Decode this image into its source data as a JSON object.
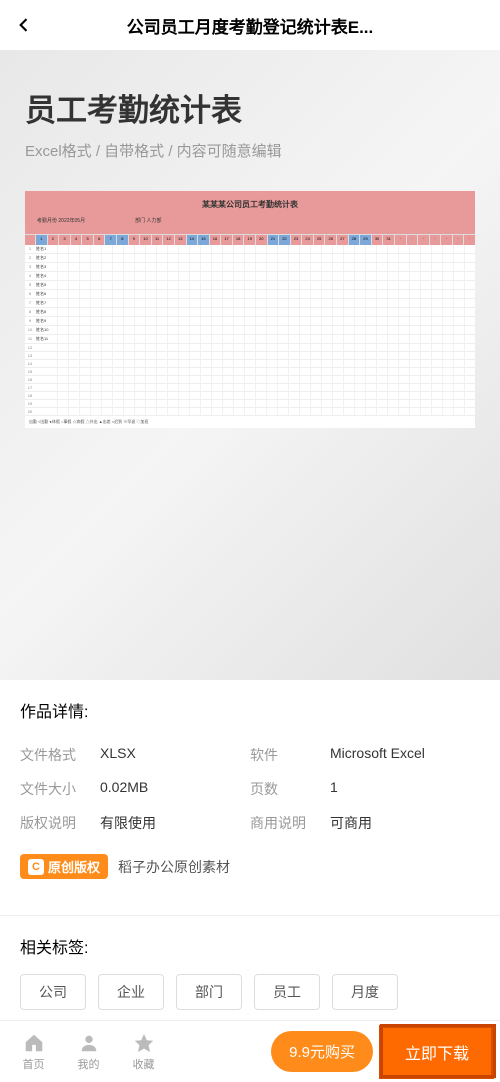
{
  "header": {
    "title": "公司员工月度考勤登记统计表E..."
  },
  "preview": {
    "title": "员工考勤统计表",
    "subtitle": "Excel格式 / 自带格式 / 内容可随意编辑",
    "excel": {
      "title": "某某某公司员工考勤统计表",
      "meta_left": "考勤月份  2022年05月",
      "meta_mid": "部门  人力部",
      "rows": [
        "姓名1",
        "姓名2",
        "姓名3",
        "姓名4",
        "姓名5",
        "姓名6",
        "姓名7",
        "姓名8",
        "姓名9",
        "姓名10",
        "姓名11"
      ],
      "legend": "出勤 √出勤  ●休假  ○事假  ☆病假  △外出  ▲出差  ×迟到  ※早退  ◇加班"
    }
  },
  "details": {
    "section_title": "作品详情:",
    "items": [
      {
        "label": "文件格式",
        "value": "XLSX"
      },
      {
        "label": "软件",
        "value": "Microsoft Excel"
      },
      {
        "label": "文件大小",
        "value": "0.02MB"
      },
      {
        "label": "页数",
        "value": "1"
      },
      {
        "label": "版权说明",
        "value": "有限使用"
      },
      {
        "label": "商用说明",
        "value": "可商用"
      }
    ],
    "badge_label": "原创版权",
    "badge_source": "稻子办公原创素材"
  },
  "tags": {
    "section_title": "相关标签:",
    "items": [
      "公司",
      "企业",
      "部门",
      "员工",
      "月度"
    ]
  },
  "bottom": {
    "nav": [
      {
        "label": "首页"
      },
      {
        "label": "我的"
      },
      {
        "label": "收藏"
      }
    ],
    "buy_label": "9.9元购买",
    "download_label": "立即下载"
  }
}
